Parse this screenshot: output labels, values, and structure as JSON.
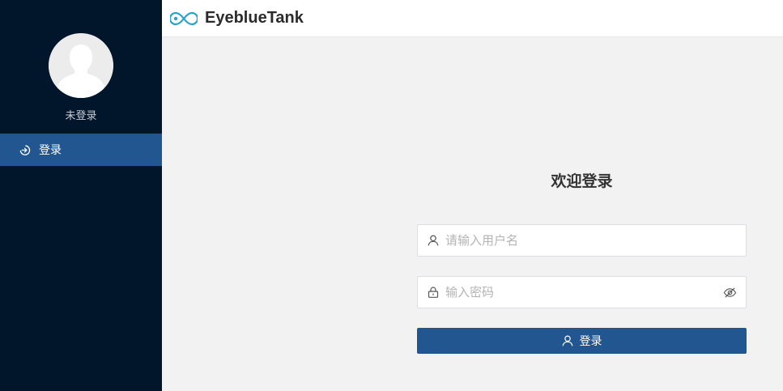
{
  "app": {
    "brand_name": "EyeblueTank",
    "logo_icon": "infinity-eye-logo"
  },
  "sidebar": {
    "user_status": "未登录",
    "avatar_icon": "default-user-avatar",
    "items": [
      {
        "label": "登录",
        "icon": "login-arrow-icon",
        "active": true
      }
    ]
  },
  "login_form": {
    "title": "欢迎登录",
    "username_placeholder": "请输入用户名",
    "username_value": "",
    "password_placeholder": "输入密码",
    "password_value": "",
    "submit_label": "登录"
  },
  "colors": {
    "sidebar_bg": "#01152b",
    "accent": "#225690",
    "page_bg": "#f2f2f2",
    "logo_teal": "#2aa3c9"
  }
}
